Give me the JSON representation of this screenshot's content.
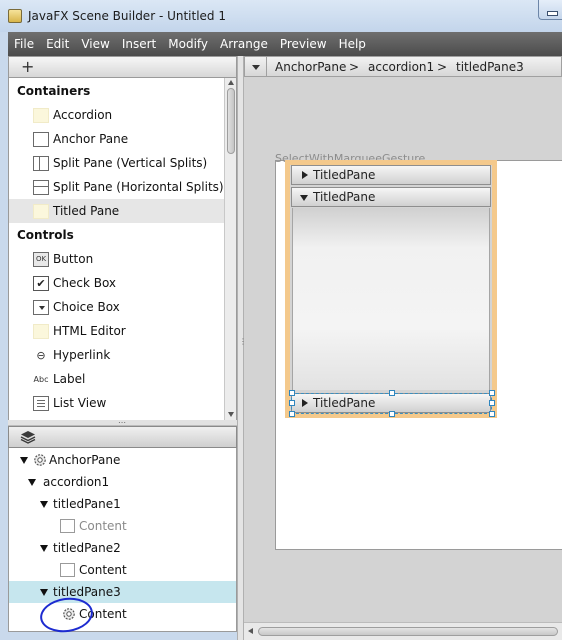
{
  "window": {
    "title": "JavaFX Scene Builder - Untitled 1"
  },
  "menubar": [
    "File",
    "Edit",
    "View",
    "Insert",
    "Modify",
    "Arrange",
    "Preview",
    "Help"
  ],
  "library": {
    "add_label": "+",
    "sections": [
      {
        "title": "Containers"
      },
      {
        "title": "Controls"
      }
    ],
    "items": [
      {
        "label": "Accordion",
        "icon": "accordion-icon"
      },
      {
        "label": "Anchor Pane",
        "icon": "anchor-pane-icon"
      },
      {
        "label": "Split Pane (Vertical Splits)",
        "icon": "split-pane-vertical-icon"
      },
      {
        "label": "Split Pane (Horizontal Splits)",
        "icon": "split-pane-horizontal-icon"
      },
      {
        "label": "Titled Pane",
        "icon": "titled-pane-icon"
      },
      {
        "label": "Button",
        "icon": "button-icon",
        "glyph": "OK"
      },
      {
        "label": "Check Box",
        "icon": "checkbox-icon",
        "glyph": "✔"
      },
      {
        "label": "Choice Box",
        "icon": "choice-box-icon"
      },
      {
        "label": "HTML Editor",
        "icon": "html-editor-icon"
      },
      {
        "label": "Hyperlink",
        "icon": "hyperlink-icon",
        "glyph": "⊖"
      },
      {
        "label": "Label",
        "icon": "label-icon",
        "glyph": "Abc"
      },
      {
        "label": "List View",
        "icon": "list-view-icon"
      }
    ]
  },
  "hierarchy": {
    "icon": "layers-icon",
    "nodes": [
      {
        "label": "AnchorPane"
      },
      {
        "label": "accordion1"
      },
      {
        "label": "titledPane1"
      },
      {
        "label": "Content"
      },
      {
        "label": "titledPane2"
      },
      {
        "label": "Content"
      },
      {
        "label": "titledPane3"
      },
      {
        "label": "Content"
      }
    ]
  },
  "breadcrumb": {
    "items": [
      "AnchorPane",
      "accordion1",
      "titledPane3"
    ],
    "separator": ">"
  },
  "canvas": {
    "gesture_label": "SelectWithMarqueeGesture",
    "titled_panes": [
      {
        "label": "TitledPane",
        "expanded": false
      },
      {
        "label": "TitledPane",
        "expanded": true
      },
      {
        "label": "TitledPane",
        "expanded": false
      }
    ]
  },
  "colors": {
    "accordion_outline": "#f4c98c",
    "selection": "#2f86bf",
    "hierarchy_selected": "#c6e6ee",
    "annotation_circle": "#1d2bd0"
  }
}
